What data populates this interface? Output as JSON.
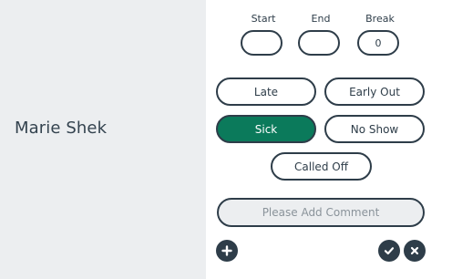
{
  "employee": {
    "name": "Marie Shek"
  },
  "times": {
    "start_label": "Start",
    "end_label": "End",
    "break_label": "Break",
    "start_value": "",
    "end_value": "",
    "break_value": "0"
  },
  "status": {
    "late": "Late",
    "early_out": "Early Out",
    "sick": "Sick",
    "no_show": "No Show",
    "called_off": "Called Off",
    "selected": "Sick"
  },
  "comment": {
    "placeholder": "Please Add Comment"
  },
  "icons": {
    "add": "plus-icon",
    "confirm": "check-icon",
    "cancel": "close-icon"
  },
  "colors": {
    "accent": "#0b7a5b",
    "dark": "#2e3d49",
    "panel": "#eceef0"
  }
}
